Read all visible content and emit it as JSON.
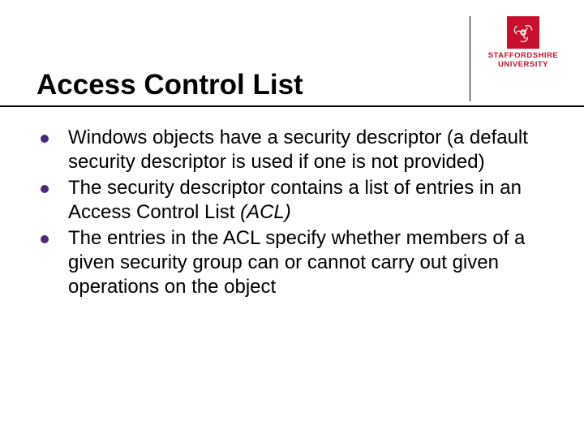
{
  "brand": {
    "name": "STAFFORDSHIRE",
    "subname": "UNIVERSITY",
    "color": "#c8102e"
  },
  "slide": {
    "title": "Access Control List",
    "bullets": [
      "Windows objects have a security descriptor (a default security descriptor is used if one is not provided)",
      "The security descriptor contains a list of entries in an Access Control List (ACL)",
      "The entries in the ACL specify whether members of a given security group can or cannot carry out given operations on the object"
    ]
  }
}
